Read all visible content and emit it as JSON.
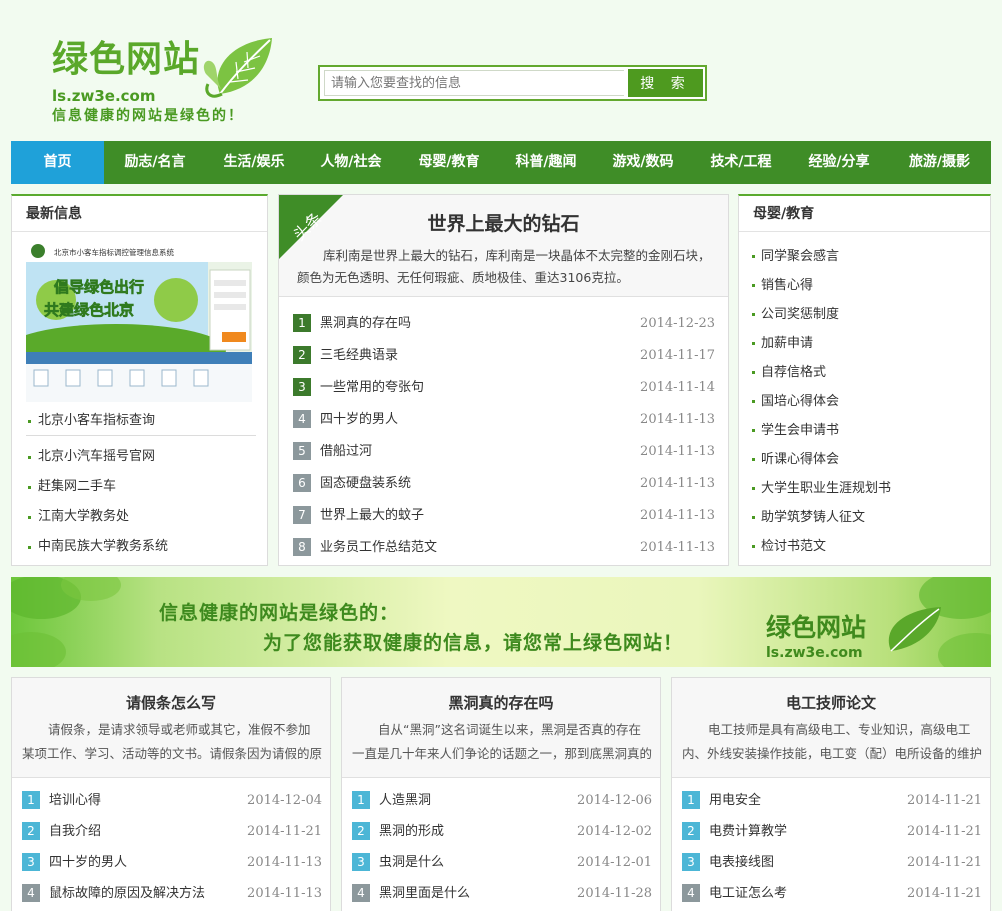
{
  "header": {
    "logo_title": "绿色网站",
    "logo_url": "ls.zw3e.com",
    "logo_slogan": "信息健康的网站是绿色的！",
    "search_placeholder": "请输入您要查找的信息",
    "search_button": "搜 索"
  },
  "nav": {
    "items": [
      "首页",
      "励志/名言",
      "生活/娱乐",
      "人物/社会",
      "母婴/教育",
      "科普/趣闻",
      "游戏/数码",
      "技术/工程",
      "经验/分享",
      "旅游/摄影"
    ]
  },
  "left": {
    "title": "最新信息",
    "image_alt": "北京市小客车指标调控管理信息系统",
    "image_slogan_1": "倡导绿色出行",
    "image_slogan_2": "共建绿色北京",
    "links": [
      "北京小客车指标查询",
      "北京小汽车摇号官网",
      "赶集网二手车",
      "江南大学教务处",
      "中南民族大学教务系统"
    ]
  },
  "headline": {
    "ribbon": "头条",
    "title": "世界上最大的钻石",
    "desc": "库利南是世界上最大的钻石，库利南是一块晶体不太完整的金刚石块，颜色为无色透明、无任何瑕疵、质地极佳、重达3106克拉。",
    "items": [
      {
        "n": "1",
        "title": "黑洞真的存在吗",
        "date": "2014-12-23"
      },
      {
        "n": "2",
        "title": "三毛经典语录",
        "date": "2014-11-17"
      },
      {
        "n": "3",
        "title": "一些常用的夸张句",
        "date": "2014-11-14"
      },
      {
        "n": "4",
        "title": "四十岁的男人",
        "date": "2014-11-13"
      },
      {
        "n": "5",
        "title": "借船过河",
        "date": "2014-11-13"
      },
      {
        "n": "6",
        "title": "固态硬盘装系统",
        "date": "2014-11-13"
      },
      {
        "n": "7",
        "title": "世界上最大的蚊子",
        "date": "2014-11-13"
      },
      {
        "n": "8",
        "title": "业务员工作总结范文",
        "date": "2014-11-13"
      }
    ]
  },
  "right": {
    "title": "母婴/教育",
    "links": [
      "同学聚会感言",
      "销售心得",
      "公司奖惩制度",
      "加薪申请",
      "自荐信格式",
      "国培心得体会",
      "学生会申请书",
      "听课心得体会",
      "大学生职业生涯规划书",
      "助学筑梦铸人征文",
      "检讨书范文"
    ]
  },
  "banner": {
    "line1": "信息健康的网站是绿色的：",
    "line2": "为了您能获取健康的信息，请您常上绿色网站！",
    "logo": "绿色网站",
    "url": "ls.zw3e.com"
  },
  "bottom": [
    {
      "title": "请假条怎么写",
      "desc": "请假条，是请求领导或老师或其它，准假不参加某项工作、学习、活动等的文书。请假条因为请假的原因，一",
      "items": [
        {
          "n": "1",
          "title": "培训心得",
          "date": "2014-12-04"
        },
        {
          "n": "2",
          "title": "自我介绍",
          "date": "2014-11-21"
        },
        {
          "n": "3",
          "title": "四十岁的男人",
          "date": "2014-11-13"
        },
        {
          "n": "4",
          "title": "鼠标故障的原因及解决方法",
          "date": "2014-11-13"
        }
      ]
    },
    {
      "title": "黑洞真的存在吗",
      "desc": "自从“黑洞”这名词诞生以来，黑洞是否真的存在一直是几十年来人们争论的话题之一，那到底黑洞真的存在",
      "items": [
        {
          "n": "1",
          "title": "人造黑洞",
          "date": "2014-12-06"
        },
        {
          "n": "2",
          "title": "黑洞的形成",
          "date": "2014-12-02"
        },
        {
          "n": "3",
          "title": "虫洞是什么",
          "date": "2014-12-01"
        },
        {
          "n": "4",
          "title": "黑洞里面是什么",
          "date": "2014-11-28"
        }
      ]
    },
    {
      "title": "电工技师论文",
      "desc": "电工技师是具有高级电工、专业知识，高级电工内、外线安装操作技能，电工变（配）电所设备的维护与操作",
      "items": [
        {
          "n": "1",
          "title": "用电安全",
          "date": "2014-11-21"
        },
        {
          "n": "2",
          "title": "电费计算教学",
          "date": "2014-11-21"
        },
        {
          "n": "3",
          "title": "电表接线图",
          "date": "2014-11-21"
        },
        {
          "n": "4",
          "title": "电工证怎么考",
          "date": "2014-11-21"
        }
      ]
    }
  ],
  "colors": {
    "brand_green": "#5aa82a",
    "nav_green": "#3f8d27",
    "nav_active": "#1fa1d9",
    "num_dark": "#3c7a2c",
    "num_gray": "#8c989c",
    "num_blue": "#4cb6d6"
  }
}
